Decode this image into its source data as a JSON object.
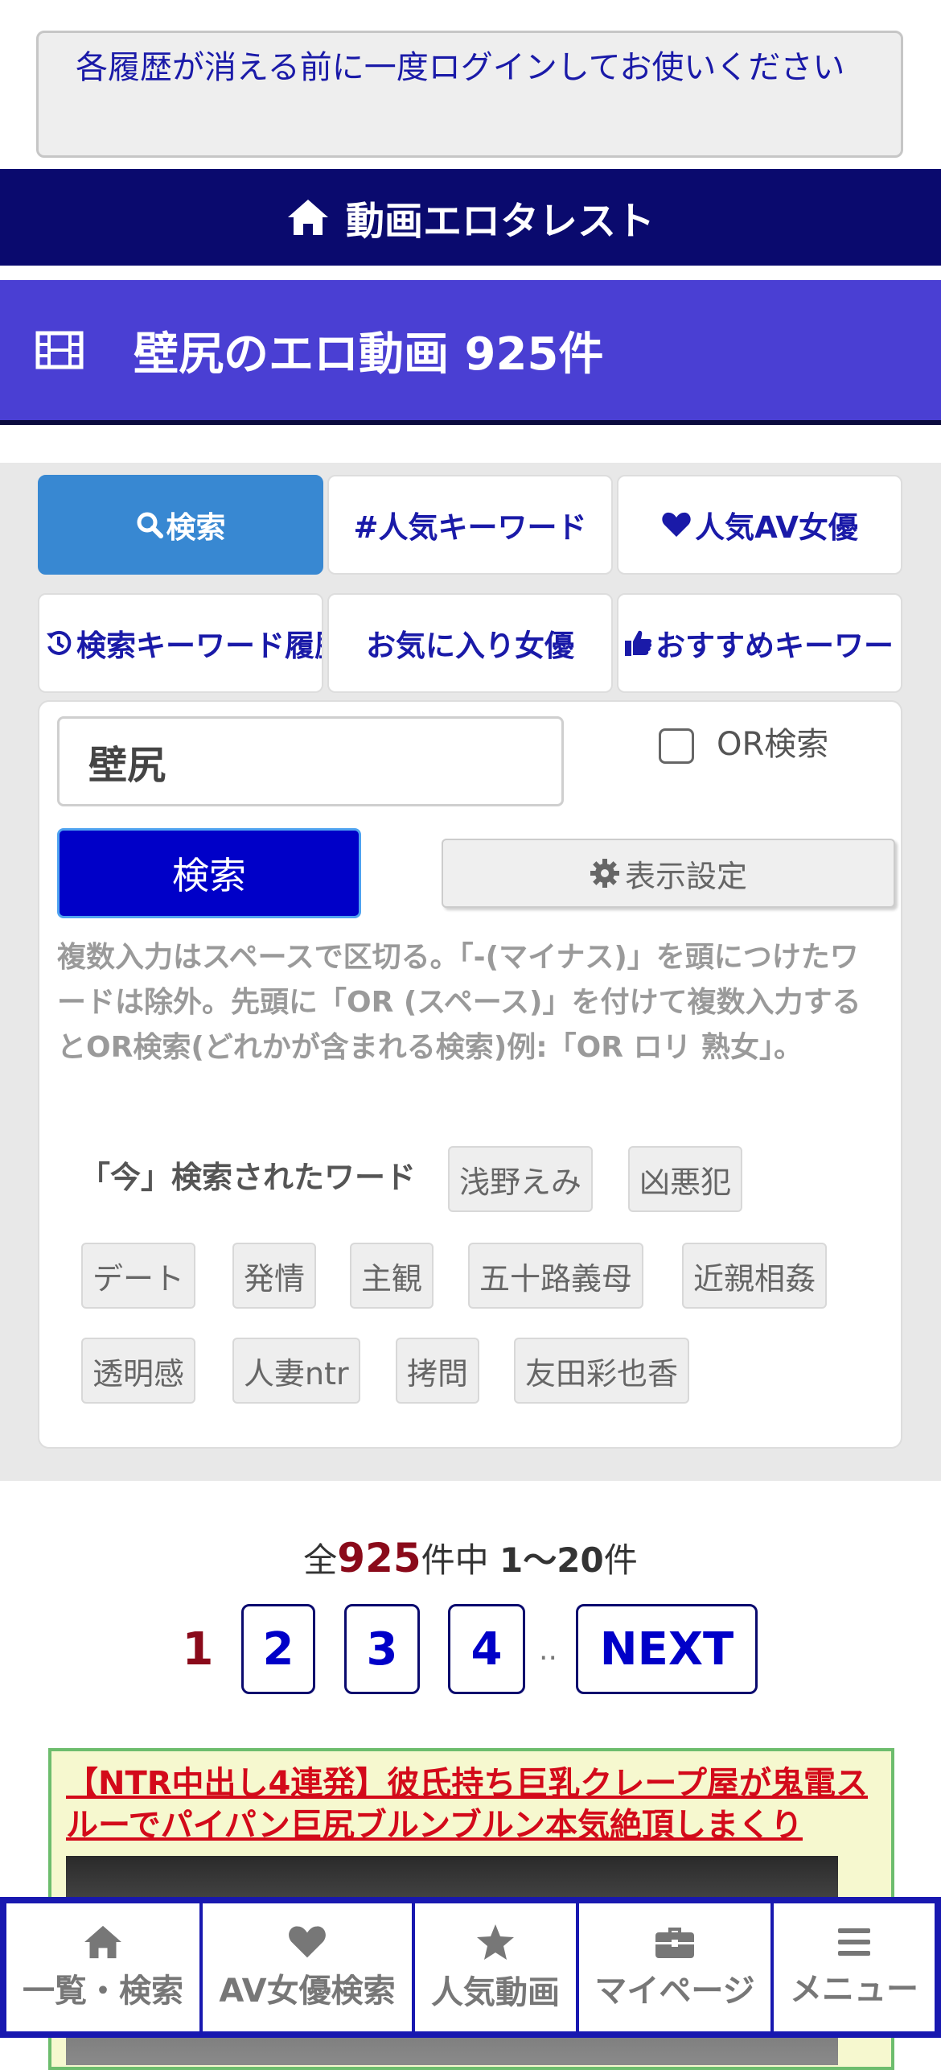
{
  "notice": {
    "text": "各履歴が消える前に一度ログインしてお使いください"
  },
  "header": {
    "title": "動画エロタレスト",
    "icon": "home-icon"
  },
  "page": {
    "title": "壁尻のエロ動画 925件",
    "icon": "film-icon"
  },
  "tabs": [
    {
      "label": "検索",
      "icon": "search-icon",
      "active": true
    },
    {
      "label": "#人気キーワード",
      "icon": ""
    },
    {
      "label": "人気AV女優",
      "icon": "heart-icon"
    },
    {
      "label": "検索キーワード履歴",
      "icon": "history-icon"
    },
    {
      "label": "お気に入り女優",
      "icon": ""
    },
    {
      "label": "おすすめキーワード",
      "icon": "thumbs-up-icon"
    }
  ],
  "search": {
    "value": "壁尻",
    "or_label": "OR検索",
    "or_checked": false,
    "button_label": "検索",
    "settings_label": "表示設定",
    "help_text": "複数入力はスペースで区切る。「-(マイナス)」を頭につけたワードは除外。先頭に「OR (スペース)」を付けて複数入力するとOR検索(どれかが含まれる検索)例:「OR ロリ 熟女」。"
  },
  "trending": {
    "label": "「今」検索されたワード",
    "tags": [
      "浅野えみ",
      "凶悪犯",
      "デート",
      "発情",
      "主観",
      "五十路義母",
      "近親相姦",
      "透明感",
      "人妻ntr",
      "拷問",
      "友田彩也香"
    ]
  },
  "pager": {
    "prefix": "全",
    "total": "925",
    "middle": "件中",
    "range": "1〜20",
    "suffix": "件",
    "current": "1",
    "pages": [
      "2",
      "3",
      "4"
    ],
    "dots": "..",
    "next": "NEXT"
  },
  "video": {
    "title": "【NTR中出し4連発】彼氏持ち巨乳クレープ屋が鬼電スルーでパイパン巨尻ブルンブルン本気絶頂しまくり"
  },
  "bottom_nav": [
    {
      "label": "一覧・検索",
      "icon": "home-icon"
    },
    {
      "label": "AV女優検索",
      "icon": "heart-icon"
    },
    {
      "label": "人気動画",
      "icon": "star-icon"
    },
    {
      "label": "マイページ",
      "icon": "briefcase-icon"
    },
    {
      "label": "メニュー",
      "icon": "menu-icon"
    }
  ],
  "colors": {
    "header_bg": "#0a0a6e",
    "title_bg": "#4a3fd3",
    "active_tab": "#3888d2",
    "search_button": "#0000c8",
    "link_blue": "#1a1aa8",
    "accent_red": "#8a0a1a",
    "bottom_nav_border": "#1818b0"
  }
}
